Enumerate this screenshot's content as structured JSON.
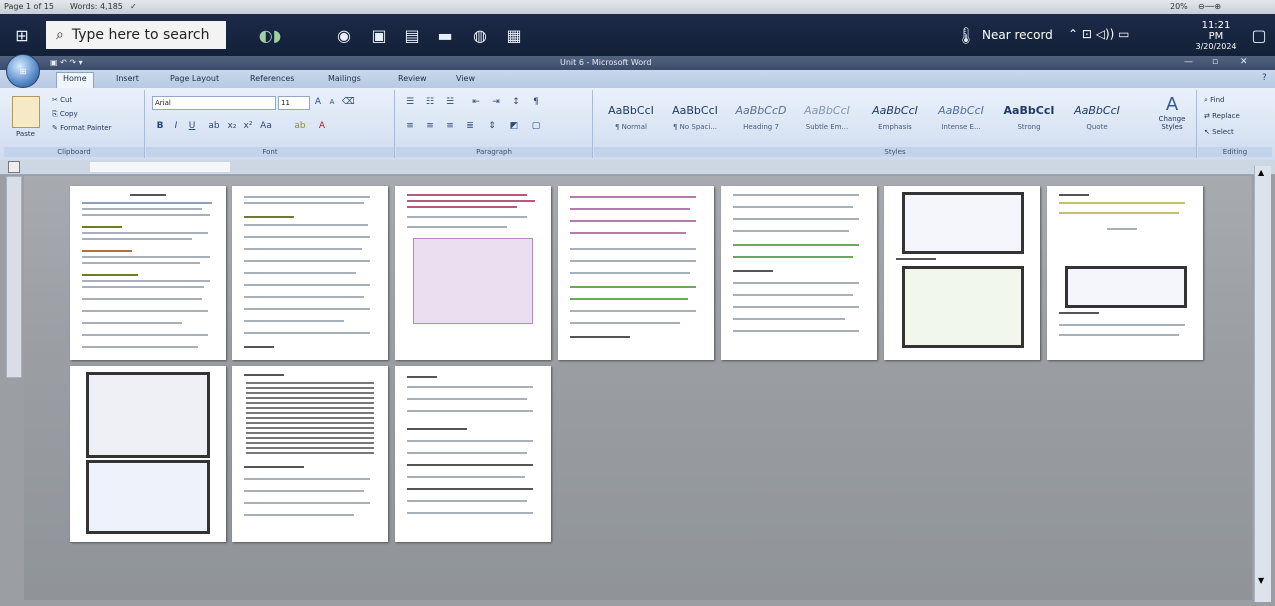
{
  "status_bar": {
    "page": "Page 1 of 15",
    "words": "Words: 4,185",
    "zoom": "20%"
  },
  "taskbar": {
    "search_placeholder": "Type here to search",
    "weather_text": "Near record",
    "time": "11:21 PM",
    "date": "3/20/2024"
  },
  "window": {
    "title": "Unit 6 - Microsoft Word"
  },
  "ribbon": {
    "tabs": [
      "Home",
      "Insert",
      "Page Layout",
      "References",
      "Mailings",
      "Review",
      "View"
    ],
    "clipboard": {
      "paste": "Paste",
      "cut": "Cut",
      "copy": "Copy",
      "format_painter": "Format Painter",
      "label": "Clipboard"
    },
    "font": {
      "name": "Arial",
      "size": "11",
      "label": "Font"
    },
    "paragraph": {
      "label": "Paragraph"
    },
    "styles": {
      "label": "Styles",
      "items": [
        {
          "sample": "AaBbCcI",
          "name": "¶ Normal"
        },
        {
          "sample": "AaBbCcI",
          "name": "¶ No Spaci..."
        },
        {
          "sample": "AaBbCcD",
          "name": "Heading 7"
        },
        {
          "sample": "AaBbCcI",
          "name": "Subtle Em..."
        },
        {
          "sample": "AaBbCcI",
          "name": "Emphasis"
        },
        {
          "sample": "AaBbCcI",
          "name": "Intense E..."
        },
        {
          "sample": "AaBbCcI",
          "name": "Strong"
        },
        {
          "sample": "AaBbCcI",
          "name": "Quote"
        }
      ],
      "change_styles": "Change Styles"
    },
    "editing": {
      "find": "Find",
      "replace": "Replace",
      "select": "Select",
      "label": "Editing"
    }
  },
  "pages": {
    "count": 10
  }
}
